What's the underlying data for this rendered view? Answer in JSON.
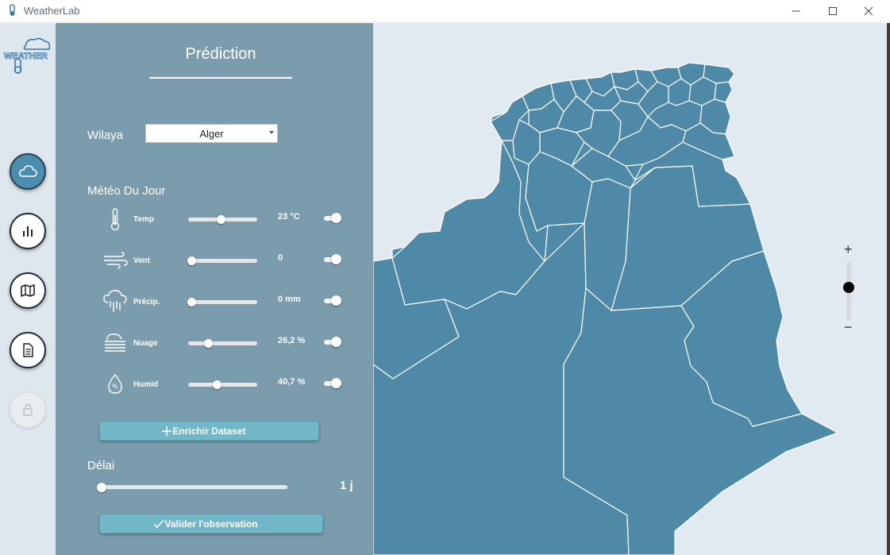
{
  "window": {
    "title": "WeatherLab",
    "controls": [
      "minimize-icon",
      "maximize-icon",
      "close-icon"
    ]
  },
  "sidebar": {
    "logo_text": "WEATHER",
    "items": [
      {
        "name": "cloud-icon",
        "active": true
      },
      {
        "name": "bar-chart-icon",
        "active": false
      },
      {
        "name": "map-icon",
        "active": false
      },
      {
        "name": "document-icon",
        "active": false
      },
      {
        "name": "lock-icon",
        "active": false,
        "disabled": true
      }
    ]
  },
  "panel": {
    "title": "Prédiction",
    "wilaya": {
      "label": "Wilaya",
      "selected": "Alger"
    },
    "meteo_label": "Météo Du Jour",
    "weather_rows": [
      {
        "icon": "thermometer-icon",
        "label": "Temp",
        "slider": 0.47,
        "value": "23 °C",
        "enabled": true
      },
      {
        "icon": "wind-icon",
        "label": "Vent",
        "slider": 0.05,
        "value": "0",
        "enabled": true
      },
      {
        "icon": "rain-icon",
        "label": "Précip.",
        "slider": 0.05,
        "value": "0 mm",
        "enabled": true
      },
      {
        "icon": "fog-icon",
        "label": "Nuage",
        "slider": 0.29,
        "value": "26,2 %",
        "enabled": true
      },
      {
        "icon": "humidity-icon",
        "label": "Humid",
        "slider": 0.41,
        "value": "40,7 %",
        "enabled": true
      }
    ],
    "enrich_button": "Enrichir Dataset",
    "delai": {
      "label": "Délai",
      "slider": 0.0,
      "value": "1 j"
    },
    "validate_button": "Valider l'observation"
  },
  "map": {
    "country_color": "#4e8aa8",
    "background": "#e2eaf1",
    "zoom": {
      "plus": "+",
      "minus": "−",
      "level": 0.57
    }
  }
}
